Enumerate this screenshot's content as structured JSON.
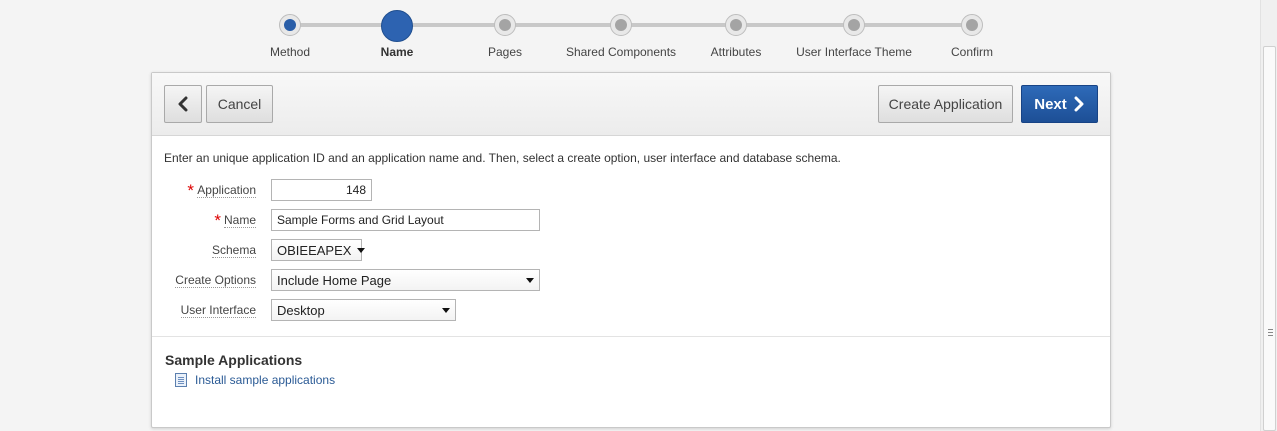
{
  "wizard": {
    "steps": [
      {
        "label": "Method",
        "state": "done"
      },
      {
        "label": "Name",
        "state": "current"
      },
      {
        "label": "Pages",
        "state": "todo"
      },
      {
        "label": "Shared Components",
        "state": "todo"
      },
      {
        "label": "Attributes",
        "state": "todo"
      },
      {
        "label": "User Interface Theme",
        "state": "todo"
      },
      {
        "label": "Confirm",
        "state": "todo"
      }
    ]
  },
  "toolbar": {
    "back_icon": "chevron-left-icon",
    "cancel_label": "Cancel",
    "create_label": "Create Application",
    "next_label": "Next",
    "next_icon": "chevron-right-icon"
  },
  "intro": "Enter an unique application ID and an application name and. Then, select a create option, user interface and database schema.",
  "form": {
    "application": {
      "label": "Application",
      "required": true,
      "value": "148"
    },
    "name": {
      "label": "Name",
      "required": true,
      "value": "Sample Forms and Grid Layout"
    },
    "schema": {
      "label": "Schema",
      "value": "OBIEEAPEX"
    },
    "create_options": {
      "label": "Create Options",
      "value": "Include Home Page"
    },
    "user_interface": {
      "label": "User Interface",
      "value": "Desktop"
    }
  },
  "sample": {
    "title": "Sample Applications",
    "link_label": "Install sample applications",
    "link_icon": "document-icon"
  },
  "colors": {
    "accent": "#2d63b1",
    "required": "#dd0000",
    "link": "#2a5a95"
  }
}
